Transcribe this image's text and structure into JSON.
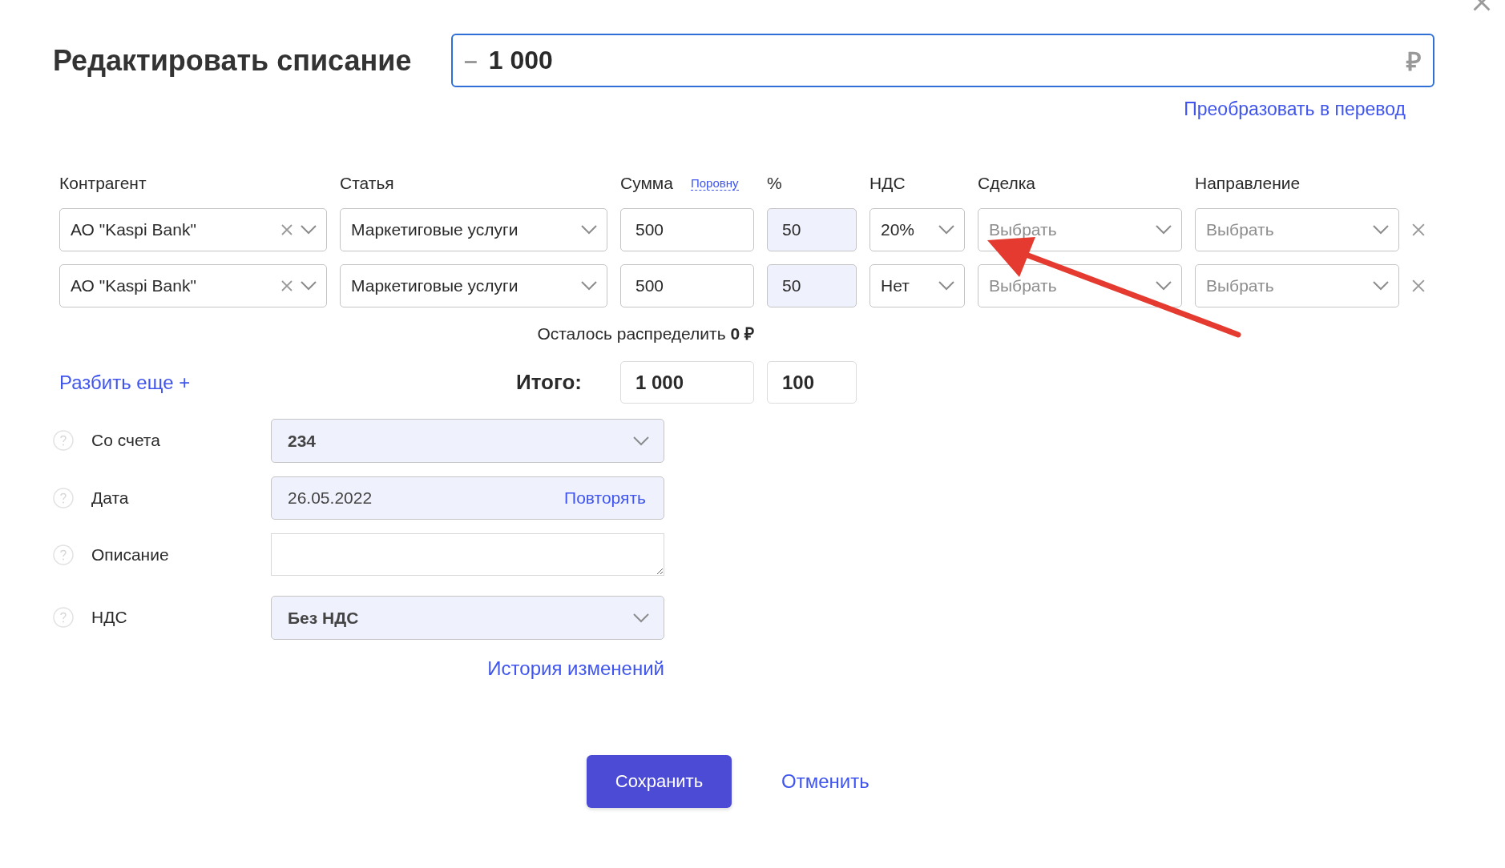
{
  "title": "Редактировать списание",
  "amount": {
    "sign": "–",
    "value": "1 000",
    "currency": "₽"
  },
  "convert_link": "Преобразовать в перевод",
  "split": {
    "columns": [
      {
        "label": "Контрагент"
      },
      {
        "label": "Статья"
      },
      {
        "label": "Сумма",
        "link": "Поровну"
      },
      {
        "label": "%"
      },
      {
        "label": "НДС"
      },
      {
        "label": "Сделка"
      },
      {
        "label": "Направление"
      }
    ],
    "rows": [
      {
        "counterparty": {
          "value": "АО \"Kaspi Bank\"",
          "clearable": true
        },
        "category": "Маркетиговые услуги",
        "amount": "500",
        "percent": "50",
        "vat": "20%",
        "deal": {
          "placeholder": "Выбрать"
        },
        "direction": {
          "placeholder": "Выбрать"
        }
      },
      {
        "counterparty": {
          "value": "АО \"Kaspi Bank\"",
          "clearable": true
        },
        "category": "Маркетиговые услуги",
        "amount": "500",
        "percent": "50",
        "vat": "Нет",
        "deal": {
          "placeholder": "Выбрать"
        },
        "direction": {
          "placeholder": "Выбрать"
        }
      }
    ],
    "remaining": "Осталось распределить **0 ₽**",
    "add_split": "Разбить еще +",
    "total": {
      "label": "Итого:",
      "amount": "1 000",
      "percent": "100"
    }
  },
  "fields": [
    {
      "kind": "select",
      "label": "Со счета",
      "value": "234"
    },
    {
      "kind": "date",
      "label": "Дата",
      "value": "26.05.2022",
      "action": "Повторять"
    },
    {
      "kind": "textarea",
      "label": "Описание"
    },
    {
      "kind": "select",
      "label": "НДС",
      "value": "Без НДС"
    }
  ],
  "history_link": "История изменений",
  "buttons": {
    "save": "Сохранить",
    "cancel": "Отменить"
  },
  "annotations": [
    {
      "kind": "arrow"
    }
  ]
}
